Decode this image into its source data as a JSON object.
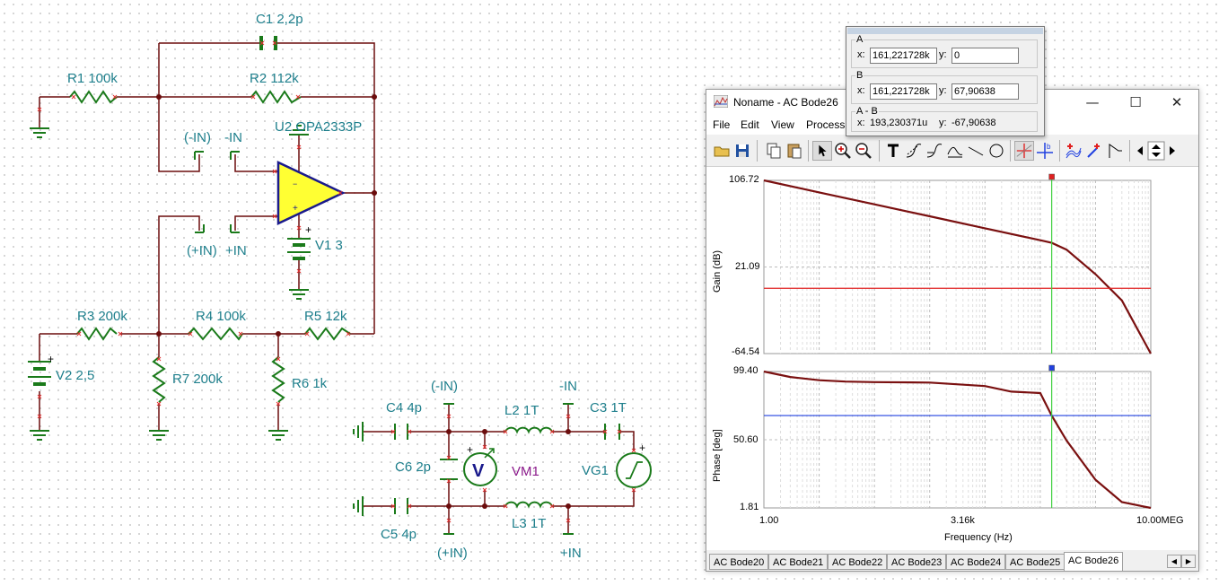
{
  "schematic": {
    "components": {
      "c1": "C1 2,2p",
      "r1": "R1 100k",
      "r2": "R2 112k",
      "minus_in_paren": "(-IN)",
      "minus_in": "-IN",
      "u2": "U2 OPA2333P",
      "plus_in_paren": "(+IN)",
      "plus_in": "+IN",
      "v1": "V1 3",
      "r3": "R3 200k",
      "r4": "R4 100k",
      "r5": "R5 12k",
      "v2": "V2 2,5",
      "r7": "R7 200k",
      "r6": "R6 1k",
      "bottom_minus_in_paren": "(-IN)",
      "bottom_minus_in": "-IN",
      "c4": "C4 4p",
      "l2": "L2 1T",
      "c3": "C3 1T",
      "c6": "C6 2p",
      "vm1": "VM1",
      "vg1": "VG1",
      "c5": "C5 4p",
      "l3": "L3 1T",
      "bottom_plus_in_paren": "(+IN)",
      "bottom_plus_in": "+IN"
    }
  },
  "bode_window": {
    "title": "Noname - AC Bode26",
    "controls": {
      "minimize": "—",
      "maximize": "☐",
      "close": "✕"
    },
    "menu": [
      "File",
      "Edit",
      "View",
      "Process"
    ],
    "toolbar_icons": [
      "open-folder-icon",
      "save-icon",
      "copy-icon",
      "paste-icon",
      "pointer-icon",
      "zoom-in-icon",
      "zoom-out-icon",
      "text-icon",
      "curve-a-icon",
      "curve-b-icon",
      "curve-c-icon",
      "line-icon",
      "circle-icon",
      "cursor-a-icon",
      "cursor-b-icon",
      "marker-a-icon",
      "marker-b-icon",
      "flag-icon",
      "scroll-left-icon",
      "spin-icon",
      "scroll-right-icon"
    ],
    "gain_plot": {
      "ylabel": "Gain (dB)",
      "ticks": [
        "106.72",
        "21.09",
        "-64.54"
      ]
    },
    "phase_plot": {
      "ylabel": "Phase [deg]",
      "ticks": [
        "99.40",
        "50.60",
        "1.81"
      ]
    },
    "x_axis": {
      "label": "Frequency (Hz)",
      "ticks": [
        "1.00",
        "3.16k",
        "10.00MEG"
      ]
    },
    "tabs": [
      "AC Bode20",
      "AC Bode21",
      "AC Bode22",
      "AC Bode23",
      "AC Bode24",
      "AC Bode25",
      "AC Bode26"
    ],
    "active_tab": "AC Bode26",
    "colors": {
      "trace": "#7a1010",
      "cursor_a": "#e02020",
      "cursor_b": "#2040e0",
      "cursor_line": "#40d040"
    }
  },
  "chart_data": [
    {
      "type": "line",
      "ylabel": "Gain (dB)",
      "xlabel": "Frequency (Hz)",
      "xscale": "log",
      "xlim": [
        1,
        10000000
      ],
      "ylim": [
        -64.54,
        106.72
      ],
      "series": [
        {
          "x": [
            1,
            10,
            100,
            1000,
            10000,
            100000,
            161222,
            300000,
            1000000,
            3000000,
            10000000
          ],
          "y": [
            106.7,
            94.8,
            83.0,
            71.2,
            59.3,
            47.5,
            45.0,
            38.2,
            14.0,
            -12.0,
            -64.5
          ]
        }
      ],
      "cursor_a_y": 0,
      "grid": true
    },
    {
      "type": "line",
      "ylabel": "Phase [deg]",
      "xlabel": "Frequency (Hz)",
      "xscale": "log",
      "xlim": [
        1,
        10000000
      ],
      "ylim": [
        1.81,
        99.4
      ],
      "series": [
        {
          "x": [
            1,
            3,
            10,
            30,
            100,
            1000,
            10000,
            30000,
            100000,
            161222,
            300000,
            1000000,
            3000000,
            10000000
          ],
          "y": [
            99.4,
            95.5,
            93.2,
            92.2,
            91.8,
            91.5,
            89.0,
            85.0,
            84.0,
            67.9,
            50.0,
            22.0,
            6.0,
            1.81
          ]
        }
      ],
      "cursor_b_y": 67.90638,
      "grid": true
    }
  ],
  "cursor_panel": {
    "a": {
      "title": "A",
      "x_label": "x:",
      "x_value": "161,221728k",
      "y_label": "y:",
      "y_value": "0"
    },
    "b": {
      "title": "B",
      "x_label": "x:",
      "x_value": "161,221728k",
      "y_label": "y:",
      "y_value": "67,90638"
    },
    "ab": {
      "title": "A - B",
      "x_label": "x:",
      "x_value": "193,230371u",
      "y_label": "y:",
      "y_value": "-67,90638"
    }
  }
}
